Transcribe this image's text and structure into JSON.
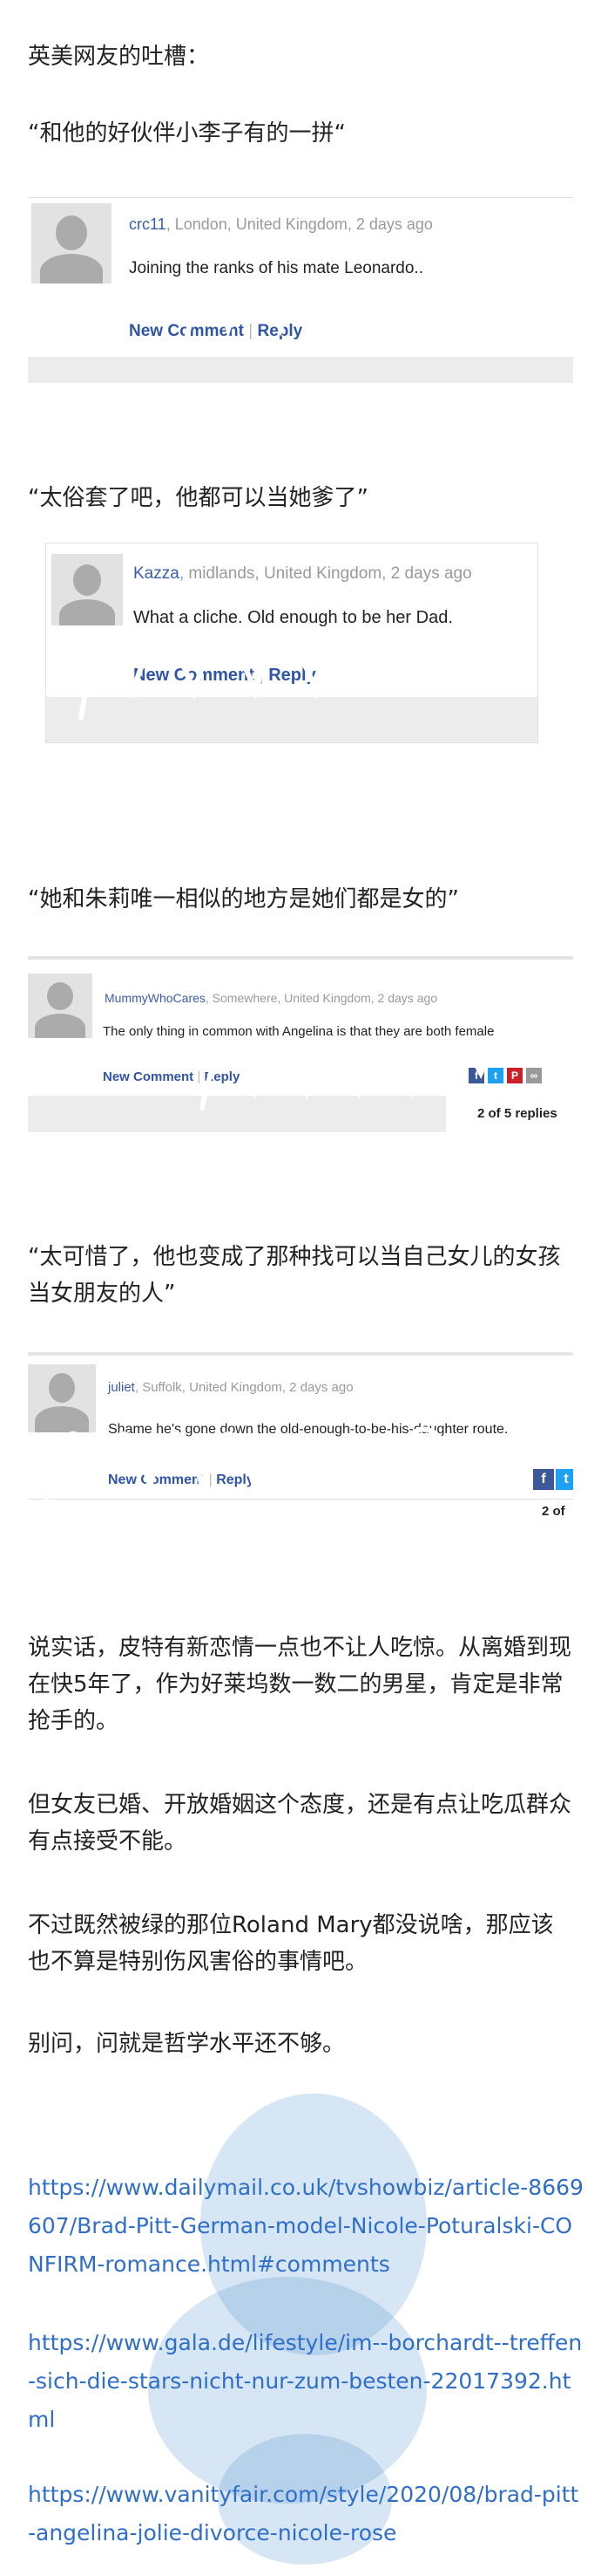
{
  "article": {
    "intro": "英美网友的吐槽：",
    "quotes": [
      "“和他的好伙伴小李子有的一拼“",
      "“太俗套了吧，他都可以当她爹了”",
      "“她和朱莉唯一相似的地方是她们都是女的”",
      "“太可惜了，他也变成了那种找可以当自己女儿的女孩当女朋友的人”"
    ],
    "paragraphs": [
      "说实话，皮特有新恋情一点也不让人吃惊。从离婚到现在快5年了，作为好莱坞数一数二的男星，肯定是非常抢手的。",
      "但女友已婚、开放婚姻这个态度，还是有点让吃瓜群众有点接受不能。",
      "不过既然被绿的那位Roland Mary都没说啥，那应该也不算是特别伤风害俗的事情吧。",
      "别问，问就是哲学水平还不够。"
    ],
    "links": [
      "https://www.dailymail.co.uk/tvshowbiz/article-8669607/Brad-Pitt-German-model-Nicole-Poturalski-CONFIRM-romance.html#comments",
      "https://www.gala.de/lifestyle/im--borchardt--treffen-sich-die-stars-nicht-nur-zum-besten-22017392.html",
      "https://www.vanityfair.com/style/2020/08/brad-pitt-angelina-jolie-divorce-nicole-rose"
    ]
  },
  "comments": [
    {
      "user": "crc11",
      "location": ", London, United Kingdom, 2 days ago",
      "text": "Joining the ranks of his mate Leonardo..",
      "new_comment": "New Comment",
      "reply": "Reply"
    },
    {
      "user": "Kazza",
      "location": ", midlands, United Kingdom, 2 days ago",
      "text": "What a cliche. Old enough to be her Dad.",
      "new_comment": "New Comment",
      "reply": "Reply"
    },
    {
      "user": "MummyWhoCares",
      "location": ", Somewhere, United Kingdom, 2 days ago",
      "text": "The only thing in common with Angelina is that they are both female",
      "new_comment": "New Comment",
      "reply": "Reply",
      "replies_count": "2 of 5 replies"
    },
    {
      "user": "juliet",
      "location": ", Suffolk, United Kingdom, 2 days ago",
      "text": "Shame he's gone down the old-enough-to-be-his-daughter route.",
      "new_comment": "New Comment",
      "reply": "Reply",
      "replies_count": "2 of"
    }
  ],
  "social_icons": [
    {
      "name": "facebook-icon",
      "glyph": "f",
      "color": "#3b5998"
    },
    {
      "name": "twitter-icon",
      "glyph": "t",
      "color": "#1da1f2"
    },
    {
      "name": "pinterest-icon",
      "glyph": "P",
      "color": "#cb2027"
    },
    {
      "name": "link-icon",
      "glyph": "∞",
      "color": "#999999"
    }
  ]
}
